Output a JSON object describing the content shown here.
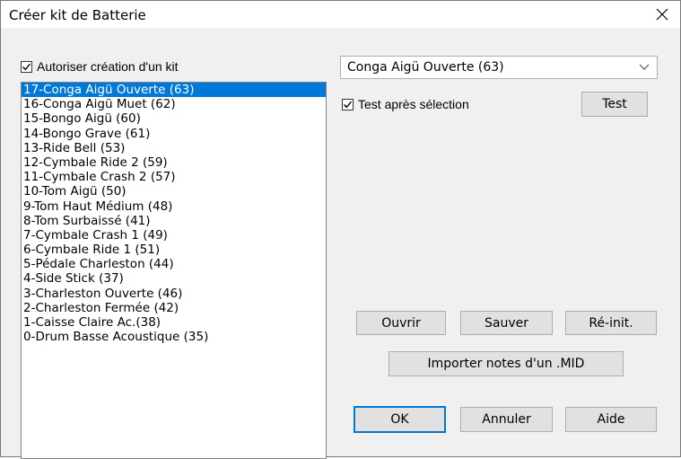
{
  "window": {
    "title": "Créer kit de Batterie"
  },
  "enable_kit": {
    "label": "Autoriser création d'un kit",
    "checked": true
  },
  "instrument_list": {
    "selected_index": 0,
    "items": [
      "17-Conga Aigü Ouverte (63)",
      "16-Conga Aigü Muet (62)",
      "15-Bongo Aigü (60)",
      "14-Bongo Grave (61)",
      "13-Ride Bell (53)",
      "12-Cymbale Ride 2 (59)",
      "11-Cymbale Crash 2 (57)",
      "10-Tom Aigü (50)",
      "9-Tom Haut Médium (48)",
      "8-Tom Surbaissé (41)",
      "7-Cymbale Crash 1 (49)",
      "6-Cymbale Ride 1 (51)",
      "5-Pédale Charleston (44)",
      "4-Side Stick (37)",
      "3-Charleston Ouverte (46)",
      "2-Charleston Fermée (42)",
      "1-Caisse Claire Ac.(38)",
      "0-Drum Basse Acoustique (35)"
    ]
  },
  "sound_select": {
    "value": "Conga Aigü Ouverte (63)"
  },
  "test_after_select": {
    "label": "Test après sélection",
    "checked": true
  },
  "buttons": {
    "test": "Test",
    "open": "Ouvrir",
    "save": "Sauver",
    "reset": "Ré-init.",
    "import": "Importer notes d'un .MID",
    "ok": "OK",
    "cancel": "Annuler",
    "help": "Aide"
  },
  "icons": {
    "close": "close-icon",
    "dropdown": "chevron-down-icon",
    "check": "checkmark-icon"
  }
}
